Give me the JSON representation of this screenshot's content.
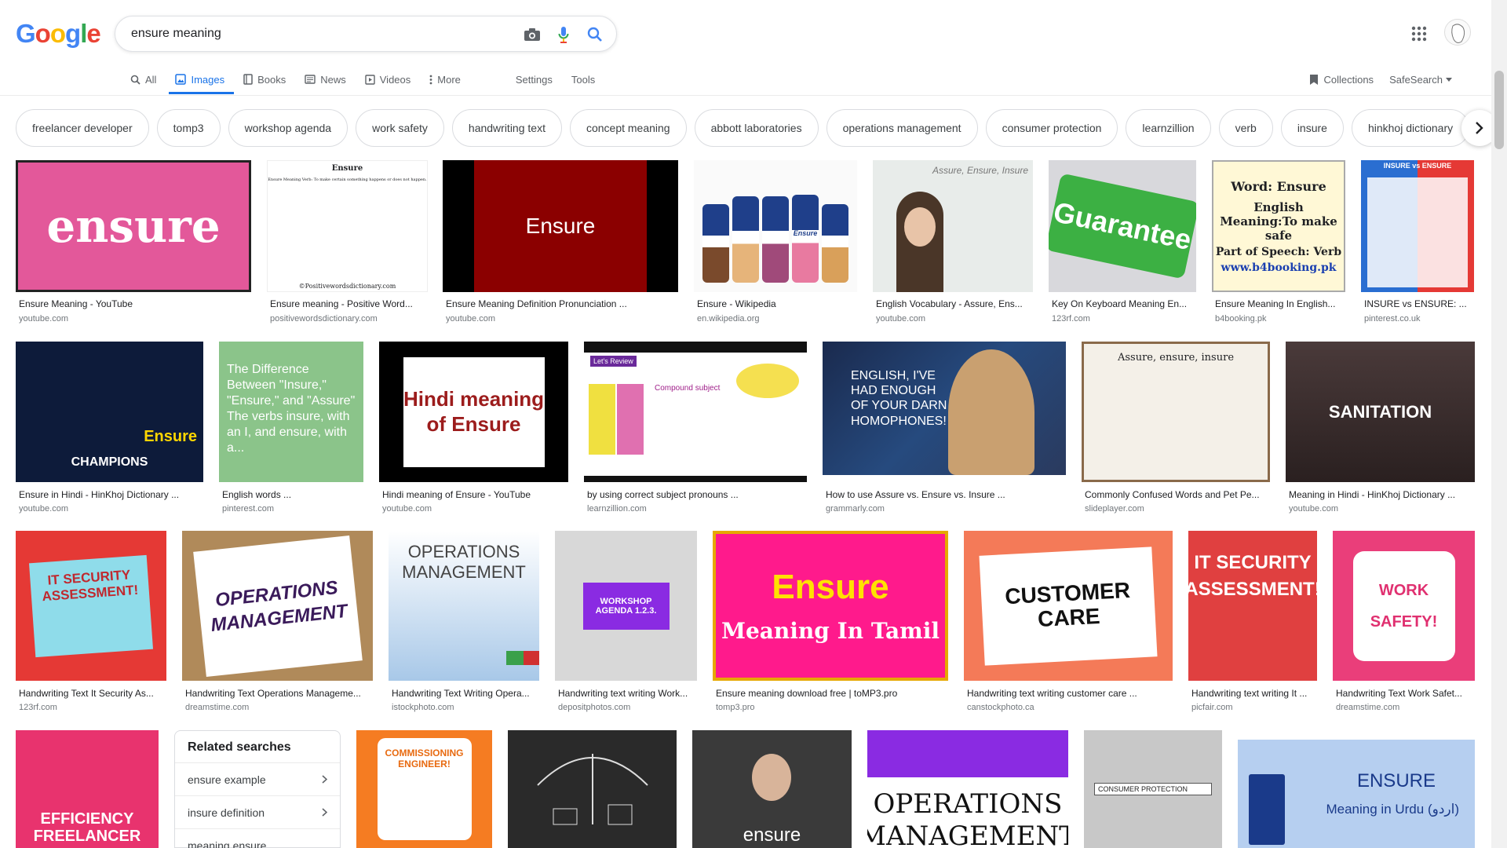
{
  "logo": {
    "letters": [
      "G",
      "o",
      "o",
      "g",
      "l",
      "e"
    ],
    "colors": [
      "#4285f4",
      "#ea4335",
      "#fbbc05",
      "#4285f4",
      "#34a853",
      "#ea4335"
    ]
  },
  "search": {
    "query": "ensure meaning"
  },
  "nav": {
    "all": "All",
    "images": "Images",
    "books": "Books",
    "news": "News",
    "videos": "Videos",
    "more": "More",
    "settings": "Settings",
    "tools": "Tools"
  },
  "right": {
    "collections": "Collections",
    "safesearch": "SafeSearch"
  },
  "chips": [
    "freelancer developer",
    "tomp3",
    "workshop agenda",
    "work safety",
    "handwriting text",
    "concept meaning",
    "abbott laboratories",
    "operations management",
    "consumer protection",
    "learnzillion",
    "verb",
    "insure",
    "hinkhoj dictionary"
  ],
  "row1": [
    {
      "caption": "Ensure Meaning - YouTube",
      "source": "youtube.com",
      "text": "ensure"
    },
    {
      "caption": "Ensure meaning - Positive Word...",
      "source": "positivewordsdictionary.com",
      "text": "Ensure",
      "sub": "Ensure Meaning Verb: To make certain something happens or does not happen.",
      "foot": "©Positivewordsdictionary.com"
    },
    {
      "caption": "Ensure Meaning Definition Pronunciation ...",
      "source": "youtube.com",
      "text": "Ensure"
    },
    {
      "caption": "Ensure - Wikipedia",
      "source": "en.wikipedia.org",
      "text": "Ensure"
    },
    {
      "caption": "English Vocabulary - Assure, Ens...",
      "source": "youtube.com",
      "text": "Assure, Ensure, Insure"
    },
    {
      "caption": "Key On Keyboard Meaning En...",
      "source": "123rf.com",
      "text": "Guarantee"
    },
    {
      "caption": "Ensure Meaning In English...",
      "source": "b4booking.pk",
      "text": "Word: Ensure",
      "sub": "English Meaning:To make safe",
      "foot": "www.b4booking.pk",
      "pos": "Part of Speech: Verb"
    },
    {
      "caption": "INSURE vs ENSURE: ...",
      "source": "pinterest.co.uk",
      "text": "INSURE vs ENSURE"
    }
  ],
  "row2": [
    {
      "caption": "Ensure in Hindi - HinKhoj Dictionary ...",
      "source": "youtube.com",
      "text": "Ensure",
      "sub": "CHAMPIONS"
    },
    {
      "caption": "English words ...",
      "source": "pinterest.com",
      "text": "The Difference Between \"Insure,\" \"Ensure,\" and \"Assure\" The verbs insure, with an I, and ensure, with a..."
    },
    {
      "caption": "Hindi meaning of Ensure - YouTube",
      "source": "youtube.com",
      "text": "Hindi meaning of Ensure"
    },
    {
      "caption": "by using correct subject pronouns ...",
      "source": "learnzillion.com",
      "text": "Compound subject",
      "sub": "Let's Review"
    },
    {
      "caption": "How to use Assure vs. Ensure vs. Insure ...",
      "source": "grammarly.com",
      "text": "ENGLISH, I'VE HAD ENOUGH OF YOUR DARN HOMOPHONES!"
    },
    {
      "caption": "Commonly Confused Words and Pet Pe...",
      "source": "slideplayer.com",
      "text": "Assure, ensure, insure"
    },
    {
      "caption": "Meaning in Hindi - HinKhoj Dictionary ...",
      "source": "youtube.com",
      "text": "SANITATION"
    }
  ],
  "row3": [
    {
      "caption": "Handwriting Text It Security As...",
      "source": "123rf.com",
      "text": "IT SECURITY ASSESSMENT!"
    },
    {
      "caption": "Handwriting Text Operations Manageme...",
      "source": "dreamstime.com",
      "text": "OPERATIONS MANAGEMENT"
    },
    {
      "caption": "Handwriting Text Writing Opera...",
      "source": "istockphoto.com",
      "text": "OPERATIONS MANAGEMENT"
    },
    {
      "caption": "Handwriting text writing Work...",
      "source": "depositphotos.com",
      "text": "WORKSHOP AGENDA 1.2.3."
    },
    {
      "caption": "Ensure meaning download free | toMP3.pro",
      "source": "tomp3.pro",
      "text": "Ensure",
      "sub": "Meaning In Tamil"
    },
    {
      "caption": "Handwriting text writing customer care ...",
      "source": "canstockphoto.ca",
      "text": "CUSTOMER CARE"
    },
    {
      "caption": "Handwriting text writing It ...",
      "source": "picfair.com",
      "text": "IT SECURITY ASSESSMENT!"
    },
    {
      "caption": "Handwriting Text Work Safet...",
      "source": "dreamstime.com",
      "text": "WORK SAFETY!"
    }
  ],
  "row4": [
    {
      "text": "EFFICIENCY FREELANCER"
    },
    {
      "text": "COMMISSIONING ENGINEER!"
    },
    {
      "text": ""
    },
    {
      "text": "ensure"
    },
    {
      "text": "OPERATIONS MANAGEMENT"
    },
    {
      "text": "CONSUMER PROTECTION"
    },
    {
      "text": "ENSURE",
      "sub": "Meaning in Urdu (اردو)"
    }
  ],
  "related": {
    "title": "Related searches",
    "items": [
      "ensure example",
      "insure definition",
      "meaning ensure"
    ]
  }
}
